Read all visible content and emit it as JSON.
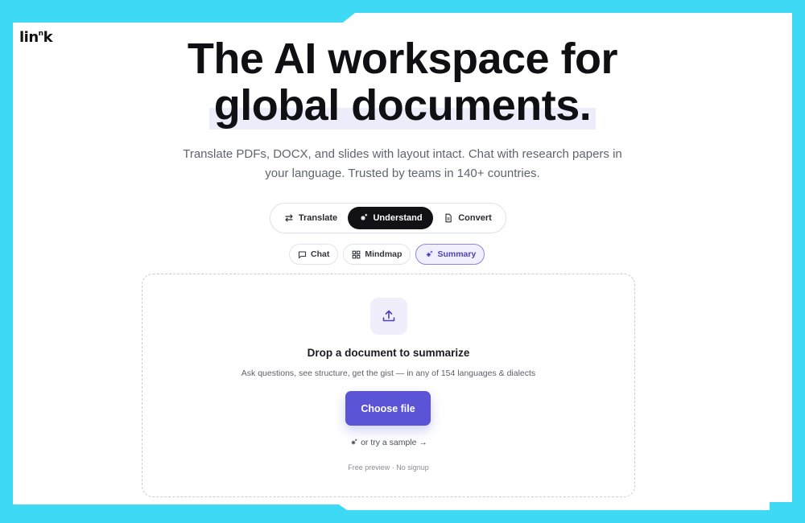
{
  "brand": {
    "logo_main": "lin",
    "logo_sup": "n",
    "logo_tail": "k"
  },
  "hero": {
    "title_line1": "The AI workspace for",
    "title_line2": "global documents.",
    "subtitle": "Translate PDFs, DOCX, and slides with layout intact. Chat with research papers in your language. Trusted by teams in 140+ countries."
  },
  "mode_tabs": [
    {
      "label": "Translate",
      "icon": "swap-arrows-icon",
      "active": false
    },
    {
      "label": "Understand",
      "icon": "sparkles-icon",
      "active": true
    },
    {
      "label": "Convert",
      "icon": "document-icon",
      "active": false
    }
  ],
  "sub_tabs": [
    {
      "label": "Chat",
      "icon": "chat-bubble-icon",
      "active": false
    },
    {
      "label": "Mindmap",
      "icon": "grid-icon",
      "active": false
    },
    {
      "label": "Summary",
      "icon": "sparkles-icon",
      "active": true
    }
  ],
  "dropzone": {
    "icon": "upload-icon",
    "title": "Drop a document to summarize",
    "subtitle": "Ask questions, see structure, get the gist — in any of 154 languages & dialects",
    "button_label": "Choose file",
    "sample_link": "or try a sample →",
    "footnote": "Free preview · No signup"
  },
  "colors": {
    "background": "#3dd9f5",
    "accent": "#5b54d6",
    "active_tab": "#111116",
    "active_chip_bg": "#f1effd"
  }
}
